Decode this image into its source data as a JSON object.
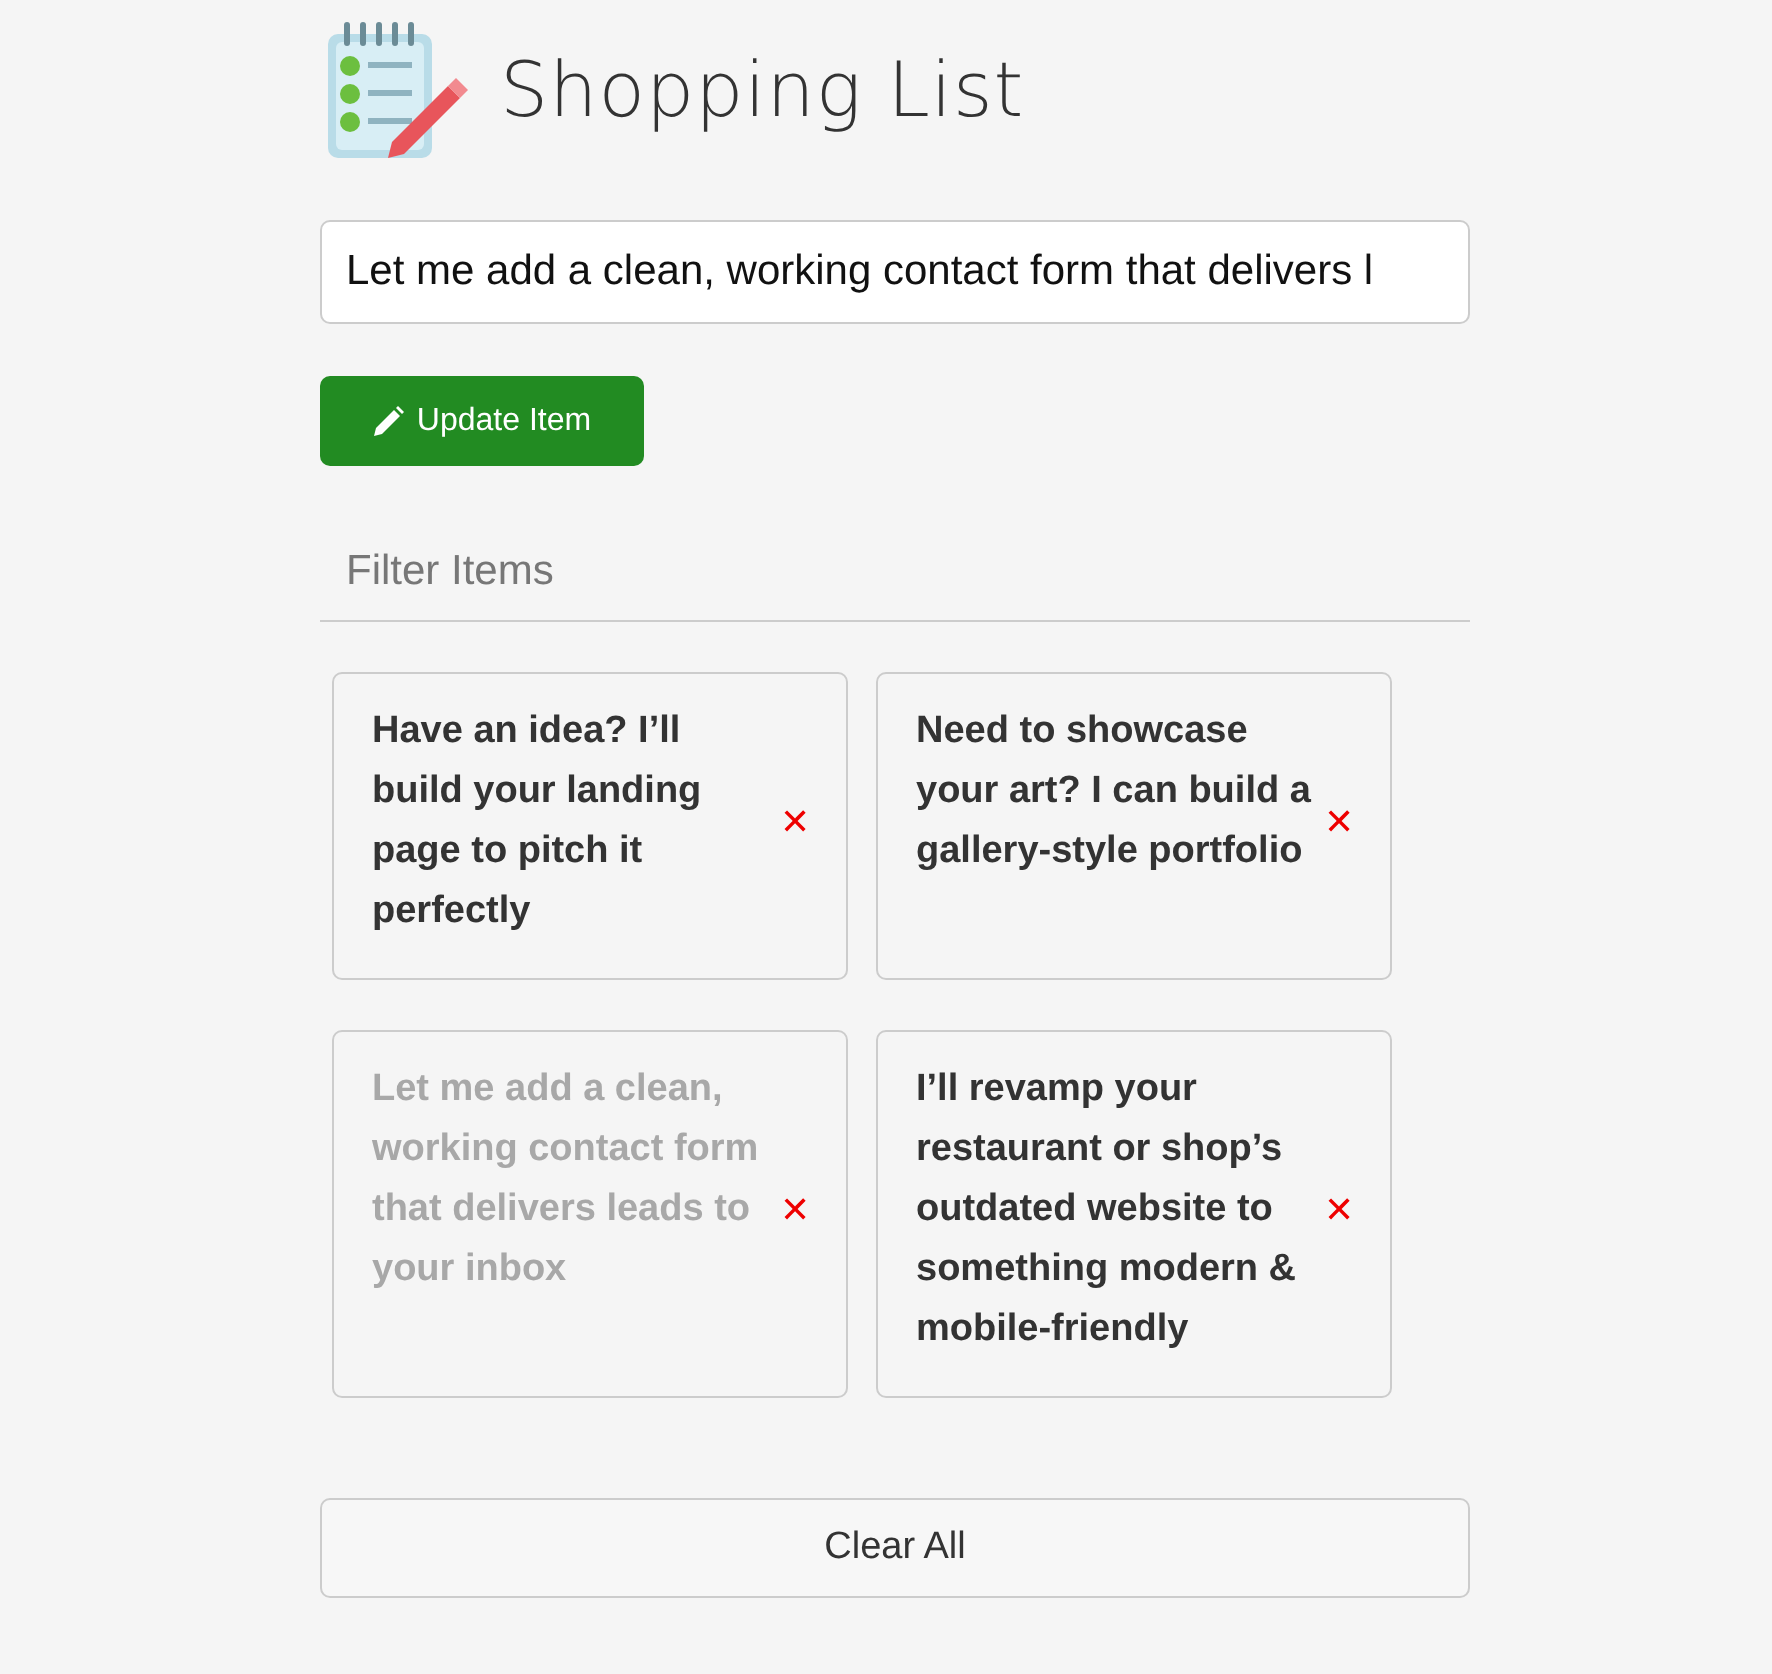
{
  "header": {
    "title": "Shopping List"
  },
  "item_input": {
    "value": "Let me add a clean, working contact form that delivers l"
  },
  "update_button": {
    "label": "Update Item"
  },
  "filter": {
    "placeholder": "Filter Items"
  },
  "items": [
    {
      "text": "Have an idea? I’ll build your landing page to pitch it perfectly",
      "editing": false,
      "remove": "✕"
    },
    {
      "text": "Need to showcase your art? I can build a gallery-style portfolio",
      "editing": false,
      "remove": "✕"
    },
    {
      "text": "Let me add a clean, working contact form that delivers leads to your inbox",
      "editing": true,
      "remove": "✕"
    },
    {
      "text": "I’ll revamp your restaurant or shop’s outdated website to something modern & mobile-friendly",
      "editing": false,
      "remove": "✕"
    }
  ],
  "clear_button": {
    "label": "Clear All"
  }
}
